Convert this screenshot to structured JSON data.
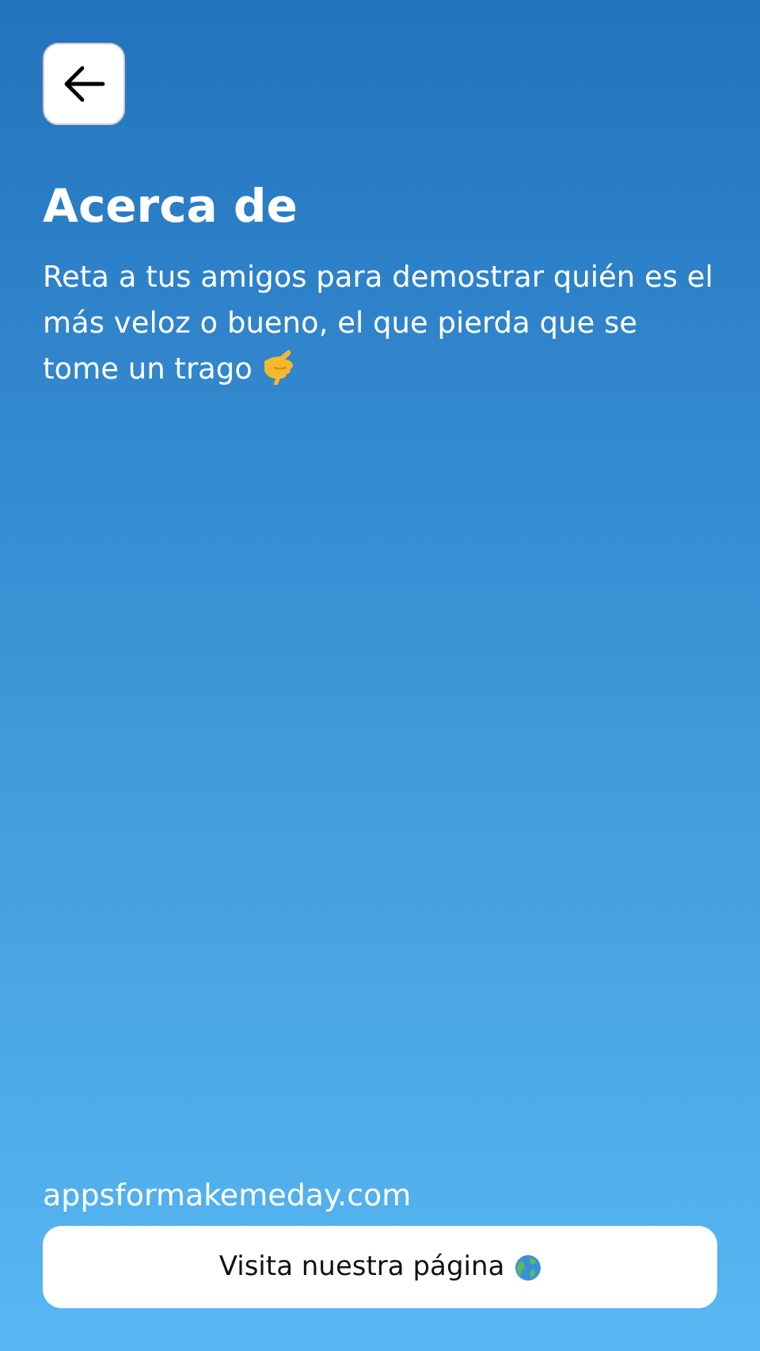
{
  "title": "Acerca de",
  "description": "Reta a tus amigos para demostrar quién es el más veloz o bueno, el que pierda que se tome un trago",
  "website": "appsformakemeday.com",
  "visit_button": {
    "label": "Visita nuestra página"
  }
}
